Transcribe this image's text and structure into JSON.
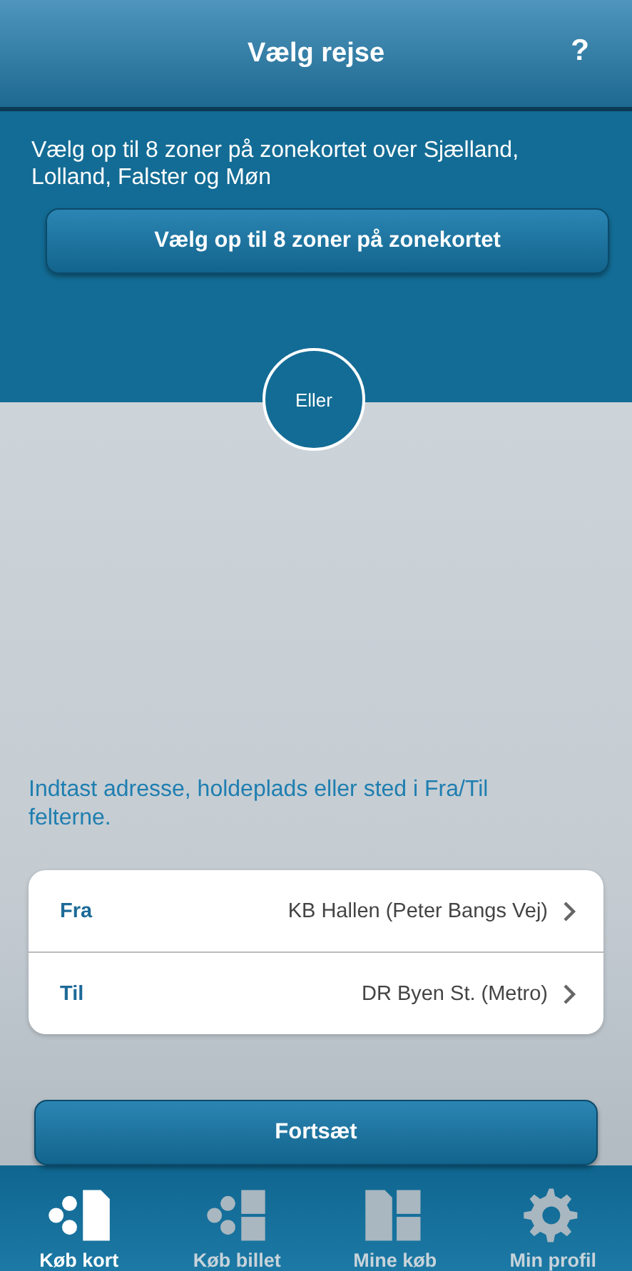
{
  "header": {
    "title": "Vælg rejse",
    "help": "?"
  },
  "zone": {
    "intro": "Vælg op til 8 zoner på zonekortet over Sjælland, Lolland, Falster og Møn",
    "button": "Vælg op til 8 zoner på zonekortet"
  },
  "divider": {
    "label": "Eller"
  },
  "address": {
    "hint": "Indtast adresse, holdeplads eller sted i Fra/Til felterne.",
    "rows": [
      {
        "label": "Fra",
        "value": "KB Hallen (Peter Bangs Vej)"
      },
      {
        "label": "Til",
        "value": "DR Byen St. (Metro)"
      }
    ]
  },
  "continue_button": "Fortsæt",
  "tabs": [
    {
      "label": "Køb kort",
      "kind": "card",
      "selected": true
    },
    {
      "label": "Køb billet",
      "kind": "ticket",
      "selected": false
    },
    {
      "label": "Mine køb",
      "kind": "purchases",
      "selected": false
    },
    {
      "label": "Min profil",
      "kind": "profile",
      "selected": false
    }
  ]
}
